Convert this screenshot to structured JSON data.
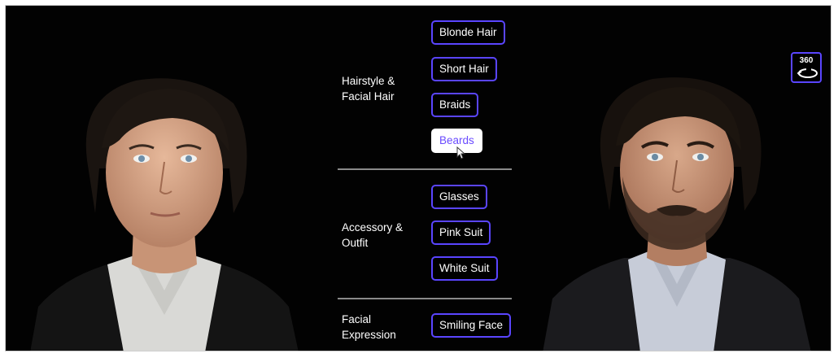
{
  "groups": [
    {
      "label_line1": "Hairstyle &",
      "label_line2": "Facial Hair",
      "options": [
        "Blonde Hair",
        "Short Hair",
        "Braids",
        "Beards"
      ],
      "active": "Beards"
    },
    {
      "label_line1": "Accessory &",
      "label_line2": "Outfit",
      "options": [
        "Glasses",
        "Pink Suit",
        "White Suit"
      ]
    },
    {
      "label_line1": "Facial",
      "label_line2": "Expression",
      "options": [
        "Smiling Face"
      ]
    }
  ],
  "rotate_button": {
    "label": "360",
    "icon": "rotate-360-icon"
  },
  "colors": {
    "background": "#020202",
    "accent": "#5a45ff",
    "active_text": "#6a4bff"
  }
}
